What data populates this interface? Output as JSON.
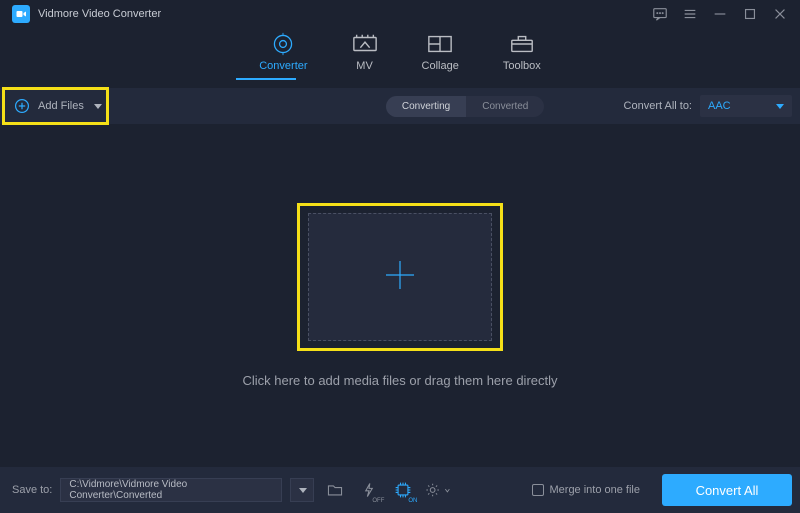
{
  "title": "Vidmore Video Converter",
  "tabs": {
    "converter": "Converter",
    "mv": "MV",
    "collage": "Collage",
    "toolbox": "Toolbox"
  },
  "toolbar": {
    "add_files": "Add Files",
    "pill_converting": "Converting",
    "pill_converted": "Converted",
    "convert_all_to": "Convert All to:",
    "format": "AAC"
  },
  "main": {
    "drop_text": "Click here to add media files or drag them here directly"
  },
  "bottom": {
    "save_to": "Save to:",
    "path": "C:\\Vidmore\\Vidmore Video Converter\\Converted",
    "merge": "Merge into one file",
    "convert": "Convert All"
  }
}
